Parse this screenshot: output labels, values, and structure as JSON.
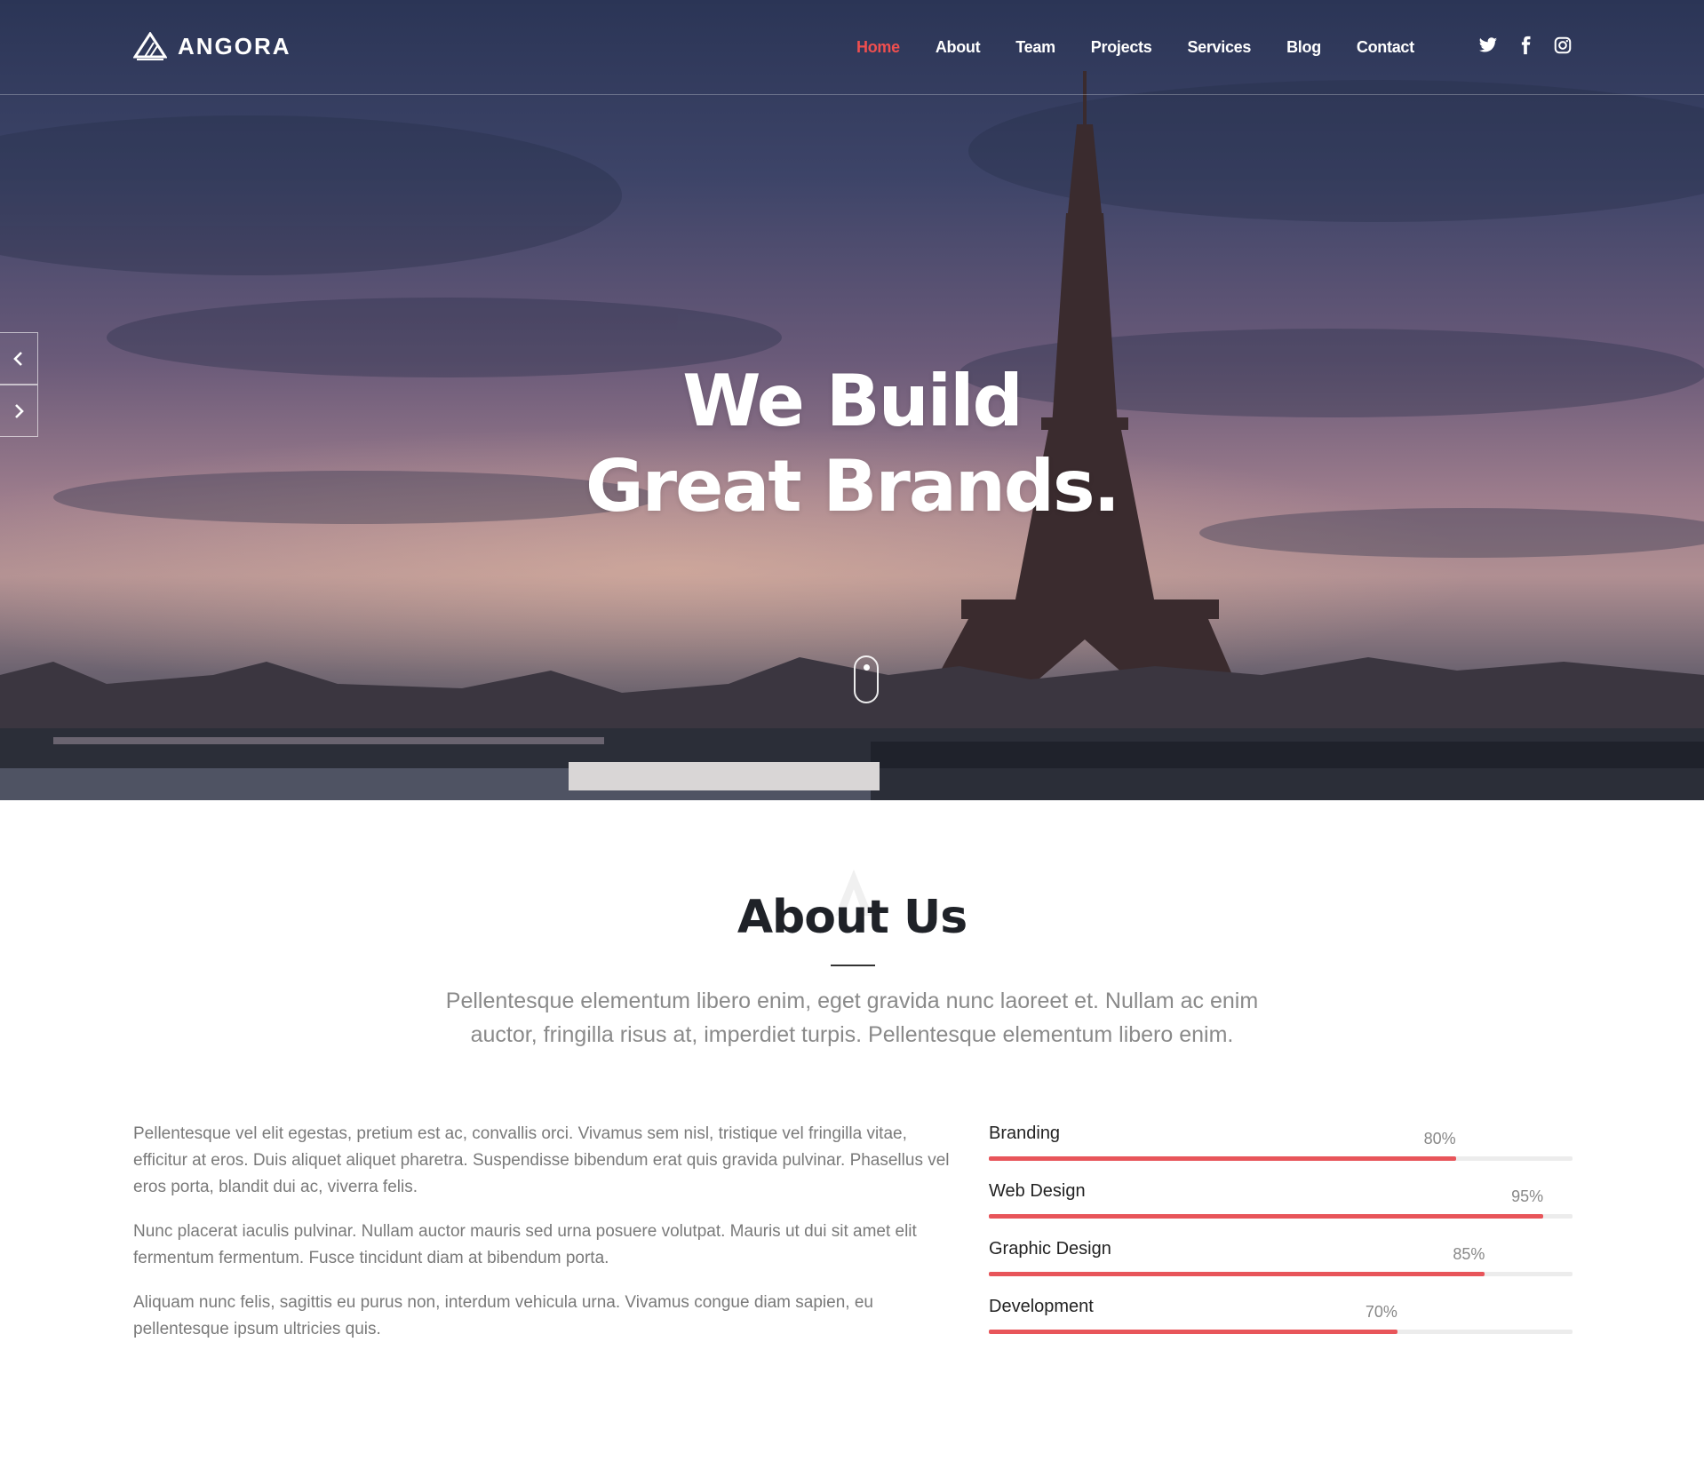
{
  "brand": {
    "name": "ANGORA",
    "logo_icon": "angora-logo-icon"
  },
  "nav": {
    "items": [
      {
        "label": "Home",
        "active": true
      },
      {
        "label": "About",
        "active": false
      },
      {
        "label": "Team",
        "active": false
      },
      {
        "label": "Projects",
        "active": false
      },
      {
        "label": "Services",
        "active": false
      },
      {
        "label": "Blog",
        "active": false
      },
      {
        "label": "Contact",
        "active": false
      }
    ],
    "active_color": "#ef4f4f"
  },
  "socials": [
    {
      "icon": "twitter-icon"
    },
    {
      "icon": "facebook-icon"
    },
    {
      "icon": "instagram-icon"
    }
  ],
  "hero": {
    "title_line1": "We Build",
    "title_line2": "Great Brands.",
    "prev_icon": "chevron-left-icon",
    "next_icon": "chevron-right-icon",
    "scroll_icon": "mouse-scroll-icon"
  },
  "about": {
    "title": "About Us",
    "lead": "Pellentesque elementum libero enim, eget gravida nunc laoreet et. Nullam ac enim auctor, fringilla risus at, imperdiet turpis. Pellentesque elementum libero enim.",
    "paragraphs": [
      "Pellentesque vel elit egestas, pretium est ac, convallis orci. Vivamus sem nisl, tristique vel fringilla vitae, efficitur at eros. Duis aliquet aliquet pharetra. Suspendisse bibendum erat quis gravida pulvinar. Phasellus vel eros porta, blandit dui ac, viverra felis.",
      "Nunc placerat iaculis pulvinar. Nullam auctor mauris sed urna posuere volutpat. Mauris ut dui sit amet elit fermentum fermentum. Fusce tincidunt diam at bibendum porta.",
      "Aliquam nunc felis, sagittis eu purus non, interdum vehicula urna. Vivamus congue diam sapien, eu pellentesque ipsum ultricies quis."
    ],
    "skills": [
      {
        "name": "Branding",
        "percent": 80,
        "label": "80%"
      },
      {
        "name": "Web Design",
        "percent": 95,
        "label": "95%"
      },
      {
        "name": "Graphic Design",
        "percent": 85,
        "label": "85%"
      },
      {
        "name": "Development",
        "percent": 70,
        "label": "70%"
      }
    ],
    "bar_color": "#e8555a"
  }
}
